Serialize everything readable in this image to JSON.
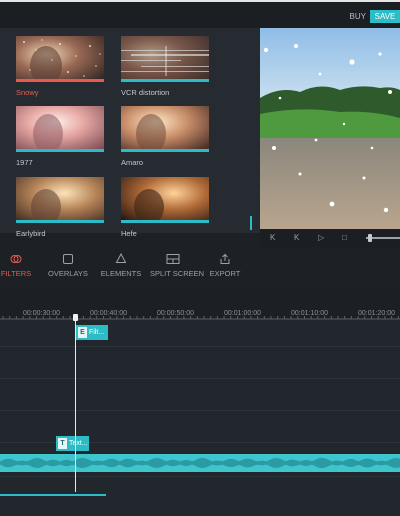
{
  "header": {
    "buy_label": "BUY",
    "save_label": "SAVE"
  },
  "filters": [
    {
      "label": "Snowy",
      "selected": true
    },
    {
      "label": "VCR distortion",
      "selected": false
    },
    {
      "label": "1977",
      "selected": false
    },
    {
      "label": "Amaro",
      "selected": false
    },
    {
      "label": "Earlybird",
      "selected": false
    },
    {
      "label": "Hefe",
      "selected": false
    }
  ],
  "player": {
    "controls": [
      {
        "icon": "skip-back-icon",
        "glyph": "K"
      },
      {
        "icon": "skip-forward-icon",
        "glyph": "K"
      },
      {
        "icon": "play-icon",
        "glyph": "▷"
      },
      {
        "icon": "stop-icon",
        "glyph": "□"
      }
    ],
    "volume_icon": "volume-slider"
  },
  "tabs": [
    {
      "label": "FILTERS",
      "icon": "filters-icon",
      "active": true
    },
    {
      "label": "OVERLAYS",
      "icon": "overlays-icon",
      "active": false
    },
    {
      "label": "ELEMENTS",
      "icon": "elements-icon",
      "active": false
    },
    {
      "label": "SPLIT SCREEN",
      "icon": "split-screen-icon",
      "active": false
    },
    {
      "label": "EXPORT",
      "icon": "export-icon",
      "active": false
    }
  ],
  "timeline": {
    "ruler_labels": [
      "00:00:30:00",
      "00:00:40:00",
      "00:00:50:00",
      "00:01:00:00",
      "00:01:10:00",
      "00:01:20:00"
    ],
    "filter_clip": {
      "glyph": "E",
      "label": "Filt..."
    },
    "text_clip": {
      "glyph": "T",
      "label": "Text..."
    }
  },
  "colors": {
    "accent": "#2bbcc7",
    "selected": "#e85a50",
    "background": "#1d2126"
  }
}
